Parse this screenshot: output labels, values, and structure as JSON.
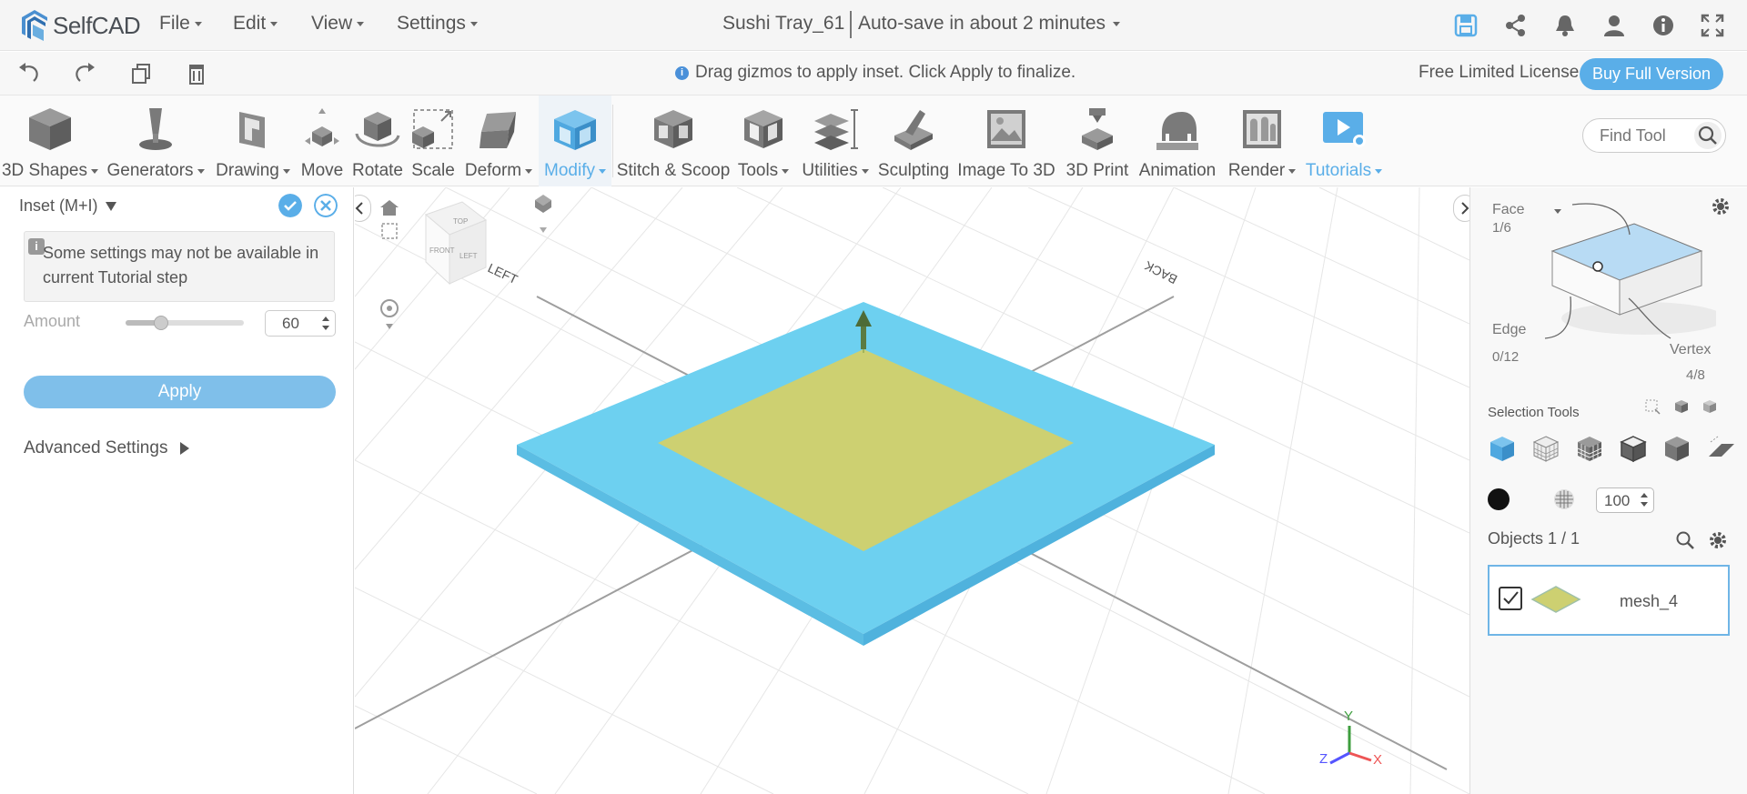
{
  "app": {
    "logo_text": "SelfCAD"
  },
  "menus": [
    {
      "label": "File"
    },
    {
      "label": "Edit"
    },
    {
      "label": "View"
    },
    {
      "label": "Settings"
    }
  ],
  "document": {
    "title": "Sushi Tray_61",
    "autosave": "Auto-save in about 2 minutes"
  },
  "topbar_icons": [
    "save-icon",
    "share-icon",
    "bell-icon",
    "user-icon",
    "info-icon",
    "fullscreen-icon"
  ],
  "secondbar": {
    "hint": "Drag gizmos to apply inset. Click Apply to finalize.",
    "license": "Free Limited License",
    "buy_label": "Buy Full Version"
  },
  "toolbar": {
    "tools": [
      {
        "label": "3D Shapes",
        "dropdown": true
      },
      {
        "label": "Generators",
        "dropdown": true
      },
      {
        "label": "Drawing",
        "dropdown": true
      },
      {
        "label": "Move"
      },
      {
        "label": "Rotate"
      },
      {
        "label": "Scale"
      },
      {
        "label": "Deform",
        "dropdown": true
      },
      {
        "label": "Modify",
        "dropdown": true,
        "active": true
      },
      {
        "label": "Stitch & Scoop"
      },
      {
        "label": "Tools",
        "dropdown": true
      },
      {
        "label": "Utilities",
        "dropdown": true
      },
      {
        "label": "Sculpting"
      },
      {
        "label": "Image To 3D"
      },
      {
        "label": "3D Print"
      },
      {
        "label": "Animation"
      },
      {
        "label": "Render",
        "dropdown": true
      },
      {
        "label": "Tutorials",
        "dropdown": true
      }
    ],
    "find_placeholder": "Find Tool"
  },
  "left_panel": {
    "title": "Inset (M+I)",
    "notice": "Some settings may not be available in current Tutorial step",
    "amount_label": "Amount",
    "amount_value": "60",
    "amount_fraction": 0.3,
    "apply_label": "Apply",
    "advanced_label": "Advanced Settings"
  },
  "viewport": {
    "cube_labels": {
      "top": "TOP",
      "left": "LEFT",
      "front": "FRONT"
    },
    "floor_labels": {
      "left": "LEFT",
      "back": "BACK"
    },
    "axis_labels": {
      "x": "X",
      "y": "Y",
      "z": "Z"
    },
    "colors": {
      "tray": "#6dd0f0",
      "inset_face": "#cdd071",
      "gizmo": "#5b7b43"
    }
  },
  "right_panel": {
    "face_label": "Face",
    "face_count": "1/6",
    "edge_label": "Edge",
    "edge_count": "0/12",
    "vertex_label": "Vertex",
    "vertex_count": "4/8",
    "selection_tools_label": "Selection Tools",
    "opacity_value": "100",
    "objects_label": "Objects 1 / 1",
    "object_name": "mesh_4"
  }
}
